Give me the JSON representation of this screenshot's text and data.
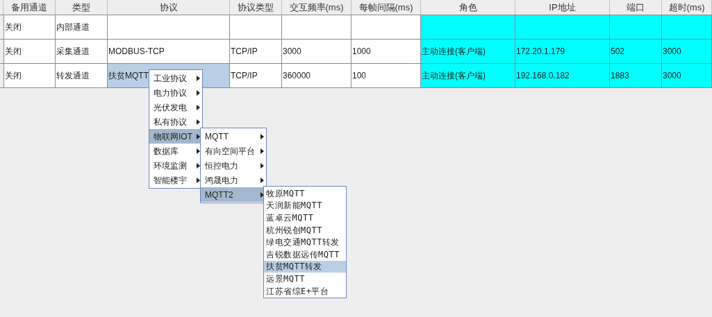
{
  "table": {
    "columns": [
      {
        "label": "备用通道",
        "highlighted": false
      },
      {
        "label": "类型",
        "highlighted": false
      },
      {
        "label": "协议",
        "highlighted": false
      },
      {
        "label": "协议类型",
        "highlighted": false
      },
      {
        "label": "交互频率(ms)",
        "highlighted": false
      },
      {
        "label": "每帧间隔(ms)",
        "highlighted": false
      },
      {
        "label": "角色",
        "highlighted": true
      },
      {
        "label": "IP地址",
        "highlighted": true
      },
      {
        "label": "端口",
        "highlighted": true
      },
      {
        "label": "超时(ms)",
        "highlighted": true
      }
    ],
    "rows": [
      {
        "cells": [
          {
            "text": "关闭",
            "selected": false
          },
          {
            "text": "内部通道",
            "selected": false
          },
          {
            "selected": false
          },
          {
            "selected": false
          },
          {
            "selected": false
          },
          {
            "selected": false
          },
          {
            "selected": false
          },
          {
            "selected": false
          },
          {
            "selected": false
          },
          {
            "selected": false
          }
        ]
      },
      {
        "cells": [
          {
            "text": "关闭",
            "selected": false
          },
          {
            "text": "采集通道",
            "selected": false
          },
          {
            "text": "MODBUS-TCP",
            "selected": false
          },
          {
            "text": "TCP/IP",
            "selected": false
          },
          {
            "text": "3000",
            "selected": false
          },
          {
            "text": "1000",
            "selected": false
          },
          {
            "text": "主动连接(客户端)",
            "selected": false
          },
          {
            "text": "172.20.1.179",
            "selected": false
          },
          {
            "text": "502",
            "selected": false
          },
          {
            "text": "3000",
            "selected": false
          }
        ]
      },
      {
        "cells": [
          {
            "text": "关闭",
            "selected": false
          },
          {
            "text": "转发通道",
            "selected": false
          },
          {
            "text": "扶贫MQTT",
            "selected": true
          },
          {
            "text": "TCP/IP",
            "selected": false
          },
          {
            "text": "360000",
            "selected": false
          },
          {
            "text": "100",
            "selected": false
          },
          {
            "text": "主动连接(客户端)",
            "selected": false
          },
          {
            "text": "192.168.0.182",
            "selected": false
          },
          {
            "text": "1883",
            "selected": false
          },
          {
            "text": "3000",
            "selected": false
          }
        ]
      }
    ]
  },
  "menus": [
    {
      "items": [
        {
          "label": "工业协议",
          "selected": false,
          "has_submenu": true
        },
        {
          "label": "电力协议",
          "selected": false,
          "has_submenu": true
        },
        {
          "label": "光伏发电",
          "selected": false,
          "has_submenu": true
        },
        {
          "label": "私有协议",
          "selected": false,
          "has_submenu": true
        },
        {
          "label": "物联网IOT",
          "selected": true,
          "has_submenu": true
        },
        {
          "label": "数据库",
          "selected": false,
          "has_submenu": true
        },
        {
          "label": "环境监测",
          "selected": false,
          "has_submenu": true
        },
        {
          "label": "智能楼宇",
          "selected": false,
          "has_submenu": true
        }
      ]
    },
    {
      "items": [
        {
          "label": "MQTT",
          "selected": false,
          "has_submenu": true
        },
        {
          "label": "有向空间平台",
          "selected": false,
          "has_submenu": true
        },
        {
          "label": "恒控电力",
          "selected": false,
          "has_submenu": true
        },
        {
          "label": "鸿晟电力",
          "selected": false,
          "has_submenu": true
        },
        {
          "label": "MQTT2",
          "selected": true,
          "has_submenu": true
        }
      ]
    },
    {
      "items": [
        {
          "label": "牧原MQTT",
          "selected": false,
          "has_submenu": false
        },
        {
          "label": "天润新能MQTT",
          "selected": false,
          "has_submenu": false
        },
        {
          "label": "蓝卓云MQTT",
          "selected": false,
          "has_submenu": false
        },
        {
          "label": "杭州锐创MQTT",
          "selected": false,
          "has_submenu": false
        },
        {
          "label": "绿电交通MQTT转发",
          "selected": false,
          "has_submenu": false
        },
        {
          "label": "吉锐数据远传MQTT",
          "selected": false,
          "has_submenu": false
        },
        {
          "label": "扶贫MQTT转发",
          "selected": true,
          "has_submenu": false
        },
        {
          "label": "远景MQTT",
          "selected": false,
          "has_submenu": false
        },
        {
          "label": "江苏省综E+平台",
          "selected": false,
          "has_submenu": false
        }
      ]
    }
  ]
}
